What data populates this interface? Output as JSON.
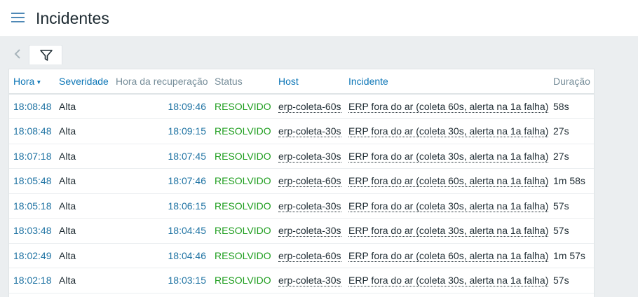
{
  "page": {
    "title": "Incidentes"
  },
  "table": {
    "headers": {
      "time": "Hora",
      "severity": "Severidade",
      "recovery": "Hora da recuperação",
      "status": "Status",
      "host": "Host",
      "problem": "Incidente",
      "duration": "Duração"
    },
    "sort_indicator": "▼",
    "rows": [
      {
        "time": "18:08:48",
        "severity": "Alta",
        "recovery": "18:09:46",
        "status": "RESOLVIDO",
        "host": "erp-coleta-60s",
        "problem": "ERP fora do ar (coleta 60s, alerta na 1a falha)",
        "duration": "58s"
      },
      {
        "time": "18:08:48",
        "severity": "Alta",
        "recovery": "18:09:15",
        "status": "RESOLVIDO",
        "host": "erp-coleta-30s",
        "problem": "ERP fora do ar (coleta 30s, alerta na 1a falha)",
        "duration": "27s"
      },
      {
        "time": "18:07:18",
        "severity": "Alta",
        "recovery": "18:07:45",
        "status": "RESOLVIDO",
        "host": "erp-coleta-30s",
        "problem": "ERP fora do ar (coleta 30s, alerta na 1a falha)",
        "duration": "27s"
      },
      {
        "time": "18:05:48",
        "severity": "Alta",
        "recovery": "18:07:46",
        "status": "RESOLVIDO",
        "host": "erp-coleta-60s",
        "problem": "ERP fora do ar (coleta 60s, alerta na 1a falha)",
        "duration": "1m 58s"
      },
      {
        "time": "18:05:18",
        "severity": "Alta",
        "recovery": "18:06:15",
        "status": "RESOLVIDO",
        "host": "erp-coleta-30s",
        "problem": "ERP fora do ar (coleta 30s, alerta na 1a falha)",
        "duration": "57s"
      },
      {
        "time": "18:03:48",
        "severity": "Alta",
        "recovery": "18:04:45",
        "status": "RESOLVIDO",
        "host": "erp-coleta-30s",
        "problem": "ERP fora do ar (coleta 30s, alerta na 1a falha)",
        "duration": "57s"
      },
      {
        "time": "18:02:49",
        "severity": "Alta",
        "recovery": "18:04:46",
        "status": "RESOLVIDO",
        "host": "erp-coleta-60s",
        "problem": "ERP fora do ar (coleta 60s, alerta na 1a falha)",
        "duration": "1m 57s"
      },
      {
        "time": "18:02:18",
        "severity": "Alta",
        "recovery": "18:03:15",
        "status": "RESOLVIDO",
        "host": "erp-coleta-30s",
        "problem": "ERP fora do ar (coleta 30s, alerta na 1a falha)",
        "duration": "57s"
      }
    ]
  },
  "icons": {
    "menu": "hamburger-menu-icon",
    "back": "chevron-left-icon",
    "filter": "filter-funnel-icon"
  },
  "colors": {
    "link": "#0b75b6",
    "resolved": "#1f9e1f",
    "menu_icon": "#4f89b6"
  }
}
